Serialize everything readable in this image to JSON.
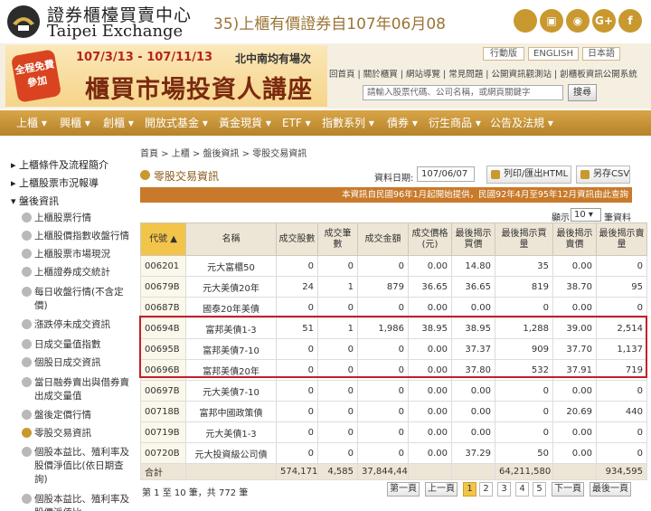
{
  "header": {
    "logo_cn": "證券櫃檯買賣中心",
    "logo_en": "Taipei Exchange",
    "marquee": "35)上櫃有價證券自107年06月08",
    "social": [
      {
        "name": "apple-icon",
        "glyph": ""
      },
      {
        "name": "android-icon",
        "glyph": "▣"
      },
      {
        "name": "rss-icon",
        "glyph": "◉"
      },
      {
        "name": "google-plus-icon",
        "glyph": "G+"
      },
      {
        "name": "facebook-icon",
        "glyph": "f"
      }
    ]
  },
  "banner": {
    "stamp": "全程免費參加",
    "date": "107/3/13 - 107/11/13",
    "sub": "北中南均有場次",
    "title": "櫃買市場投資人講座"
  },
  "lang": {
    "mobile": "行動版",
    "english": "ENGLISH",
    "japanese": "日本語"
  },
  "util_links": "回首頁 | 關於櫃買 | 網站導覽 | 常見問題 | 公開資訊觀測站 | 創櫃板資訊公開系統",
  "search": {
    "placeholder": "請輸入股票代碼、公司名稱，或網頁關鍵字",
    "button": "搜尋"
  },
  "nav": [
    "上櫃 ▾",
    "興櫃 ▾",
    "創櫃 ▾",
    "開放式基金 ▾",
    "黃金現貨 ▾",
    "ETF ▾",
    "指數系列 ▾",
    "債券 ▾",
    "衍生商品 ▾",
    "公告及法規 ▾"
  ],
  "sidebar": {
    "groups": [
      "▸ 上櫃條件及流程簡介",
      "▸ 上櫃股票市況報導",
      "▾ 盤後資訊"
    ],
    "items": [
      "上櫃股票行情",
      "上櫃股價指數收盤行情",
      "上櫃股票市場現況",
      "上櫃證券成交統計",
      "每日收盤行情(不含定價)",
      "漲跌停未成交資訊",
      "日成交量值指數",
      "個股日成交資訊",
      "當日融券賣出與借券賣出成交量值",
      "盤後定價行情",
      "零股交易資訊",
      "個股本益比、殖利率及股價淨值比(依日期查詢)",
      "個股本益比、殖利率及股價淨值比"
    ]
  },
  "breadcrumb": "首頁 > 上櫃 > 盤後資訊 > 零股交易資訊",
  "page_title": "零股交易資訊",
  "date_label": "資料日期:",
  "date_value": "107/06/07",
  "print_button": "列印/匯出HTML",
  "csv_button": "另存CSV",
  "notice": "本資訊自民國96年1月起開始提供，民國92年4月至95年12月資訊由此查詢",
  "show": {
    "label": "顯示",
    "value": "10 ▾",
    "unit": "筆資料"
  },
  "table": {
    "headers": [
      "代號 ▲",
      "名稱",
      "成交股數",
      "成交筆數",
      "成交金額",
      "成交價格(元)",
      "最後揭示買價",
      "最後揭示買量",
      "最後揭示賣價",
      "最後揭示賣量"
    ],
    "rows": [
      [
        "006201",
        "元大富櫃50",
        "0",
        "0",
        "0",
        "0.00",
        "14.80",
        "35",
        "0.00",
        "0"
      ],
      [
        "00679B",
        "元大美債20年",
        "24",
        "1",
        "879",
        "36.65",
        "36.65",
        "819",
        "38.70",
        "95"
      ],
      [
        "00687B",
        "國泰20年美債",
        "0",
        "0",
        "0",
        "0.00",
        "0.00",
        "0",
        "0.00",
        "0"
      ],
      [
        "00694B",
        "富邦美債1-3",
        "51",
        "1",
        "1,986",
        "38.95",
        "38.95",
        "1,288",
        "39.00",
        "2,514"
      ],
      [
        "00695B",
        "富邦美債7-10",
        "0",
        "0",
        "0",
        "0.00",
        "37.37",
        "909",
        "37.70",
        "1,137"
      ],
      [
        "00696B",
        "富邦美債20年",
        "0",
        "0",
        "0",
        "0.00",
        "37.80",
        "532",
        "37.91",
        "719"
      ],
      [
        "00697B",
        "元大美債7-10",
        "0",
        "0",
        "0",
        "0.00",
        "0.00",
        "0",
        "0.00",
        "0"
      ],
      [
        "00718B",
        "富邦中國政策債",
        "0",
        "0",
        "0",
        "0.00",
        "0.00",
        "0",
        "20.69",
        "440"
      ],
      [
        "00719B",
        "元大美債1-3",
        "0",
        "0",
        "0",
        "0.00",
        "0.00",
        "0",
        "0.00",
        "0"
      ],
      [
        "00720B",
        "元大投資級公司債",
        "0",
        "0",
        "0",
        "0.00",
        "37.29",
        "50",
        "0.00",
        "0"
      ]
    ],
    "total": [
      "合計",
      "",
      "574,171",
      "4,585",
      "37,844,441",
      "",
      "",
      "64,211,580",
      "",
      "934,595"
    ]
  },
  "pager": {
    "info": "第 1 至 10 筆，共 772 筆",
    "first": "第一頁",
    "prev": "上一頁",
    "pages": [
      "1",
      "2",
      "3",
      "4",
      "5"
    ],
    "next": "下一頁",
    "last": "最後一頁"
  }
}
